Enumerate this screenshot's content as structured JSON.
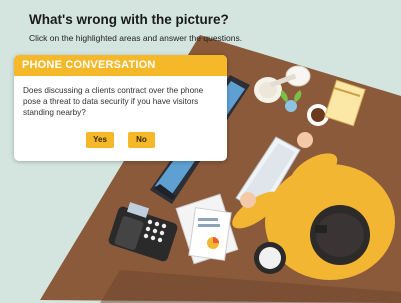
{
  "header": {
    "title": "What's wrong with the picture?",
    "instructions": "Click on the highlighted areas and answer the questions."
  },
  "dialog": {
    "title": "PHONE CONVERSATION",
    "question": "Does discussing a clients contract over the phone pose a threat to data security if you have visitors standing nearby?",
    "yes_label": "Yes",
    "no_label": "No"
  },
  "colors": {
    "background": "#d4e5e0",
    "accent": "#f4b829",
    "desk": "#8a5a3b",
    "shirt": "#f2b632"
  }
}
